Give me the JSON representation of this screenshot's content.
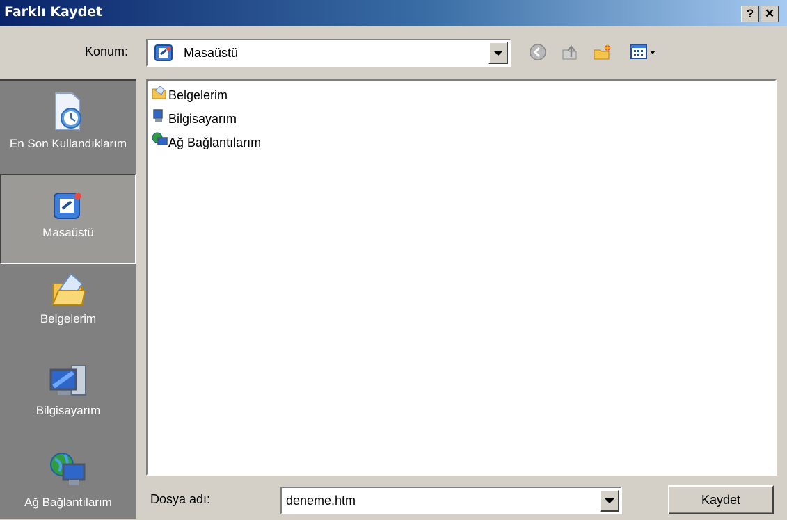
{
  "window": {
    "title": "Farklı Kaydet",
    "help_label": "?",
    "close_label": "✕"
  },
  "location": {
    "label": "Konum:",
    "value": "Masaüstü"
  },
  "toolbar": {
    "icons": [
      "back-icon",
      "up-folder-icon",
      "new-folder-icon",
      "view-menu-icon"
    ]
  },
  "places": [
    {
      "label": "En Son Kullandıklarım",
      "icon": "recent-documents-icon"
    },
    {
      "label": "Masaüstü",
      "icon": "desktop-icon"
    },
    {
      "label": "Belgelerim",
      "icon": "my-documents-icon"
    },
    {
      "label": "Bilgisayarım",
      "icon": "my-computer-icon"
    },
    {
      "label": "Ağ Bağlantılarım",
      "icon": "network-places-icon"
    }
  ],
  "files": [
    {
      "name": "Belgelerim",
      "icon": "folder-documents-icon"
    },
    {
      "name": "Bilgisayarım",
      "icon": "computer-icon"
    },
    {
      "name": "Ağ Bağlantılarım",
      "icon": "network-icon"
    }
  ],
  "filename": {
    "label": "Dosya adı:",
    "value": "deneme.htm"
  },
  "buttons": {
    "save": "Kaydet"
  },
  "colors": {
    "title_start": "#0a246a",
    "title_end": "#a6caf0",
    "dialog_bg": "#d4d0c8",
    "places_bg": "#808080"
  }
}
